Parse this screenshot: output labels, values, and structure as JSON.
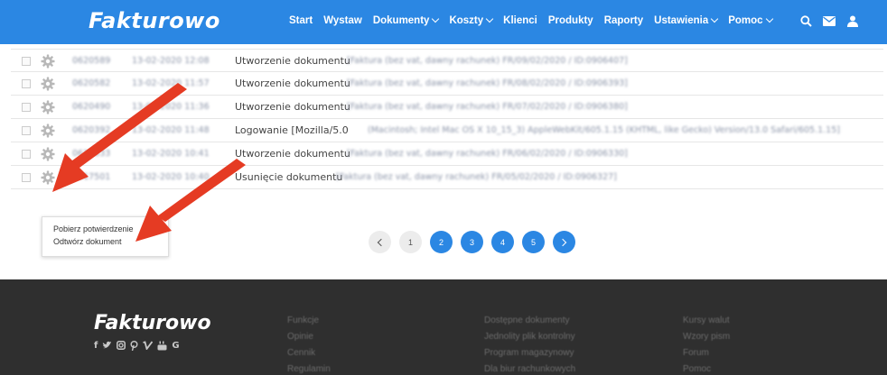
{
  "header": {
    "logo": "Fakturowo",
    "nav": [
      {
        "label": "Start",
        "dropdown": false
      },
      {
        "label": "Wystaw",
        "dropdown": false
      },
      {
        "label": "Dokumenty",
        "dropdown": true
      },
      {
        "label": "Koszty",
        "dropdown": true
      },
      {
        "label": "Klienci",
        "dropdown": false
      },
      {
        "label": "Produkty",
        "dropdown": false
      },
      {
        "label": "Raporty",
        "dropdown": false
      },
      {
        "label": "Ustawienia",
        "dropdown": true
      },
      {
        "label": "Pomoc",
        "dropdown": true
      }
    ],
    "icons": [
      "search-icon",
      "envelope-icon",
      "user-icon"
    ]
  },
  "log_rows": [
    {
      "id": "0620589",
      "date": "13-02-2020 12:08",
      "action": "Utworzenie dokumentu",
      "detail": "[Faktura (bez vat, dawny rachunek) FR/09/02/2020 / ID:0906407]"
    },
    {
      "id": "0620582",
      "date": "13-02-2020 11:57",
      "action": "Utworzenie dokumentu",
      "detail": "[Faktura (bez vat, dawny rachunek) FR/08/02/2020 / ID:0906393]"
    },
    {
      "id": "0620490",
      "date": "13-02-2020 11:36",
      "action": "Utworzenie dokumentu",
      "detail": "[Faktura (bez vat, dawny rachunek) FR/07/02/2020 / ID:0906380]"
    },
    {
      "id": "0620392",
      "date": "13-02-2020 11:48",
      "action": "Logowanie [Mozilla/5.0",
      "detail": "(Macintosh; Intel Mac OS X 10_15_3) AppleWebKit/605.1.15 (KHTML, like Gecko) Version/13.0 Safari/605.1.15]"
    },
    {
      "id": "0617633",
      "date": "13-02-2020 10:41",
      "action": "Utworzenie dokumentu",
      "detail": "[Faktura (bez vat, dawny rachunek) FR/06/02/2020 / ID:0906330]"
    },
    {
      "id": "0617501",
      "date": "13-02-2020 10:40",
      "action": "Usunięcie dokumentu",
      "detail": "[Faktura (bez vat, dawny rachunek) FR/05/02/2020 / ID:0906327]"
    }
  ],
  "popup": {
    "items": [
      "Pobierz potwierdzenie",
      "Odtwórz dokument"
    ]
  },
  "pagination": {
    "pages": [
      "1",
      "2",
      "3",
      "4",
      "5"
    ],
    "active_pages": [
      "2",
      "3",
      "4",
      "5"
    ]
  },
  "footer": {
    "logo": "Fakturowo",
    "socials": [
      "f",
      "t",
      "ig",
      "p",
      "v",
      "yt",
      "G"
    ],
    "col1": [
      "Funkcje",
      "Opinie",
      "Cennik",
      "Regulamin"
    ],
    "col2": [
      "Dostępne dokumenty",
      "Jednolity plik kontrolny",
      "Program magazynowy",
      "Dla biur rachunkowych"
    ],
    "col3": [
      "Kursy walut",
      "Wzory pism",
      "Forum",
      "Pomoc"
    ]
  },
  "colors": {
    "brand_blue": "#2b87e3",
    "footer_bg": "#2f2f2f",
    "annotation_red": "#e53b23"
  }
}
